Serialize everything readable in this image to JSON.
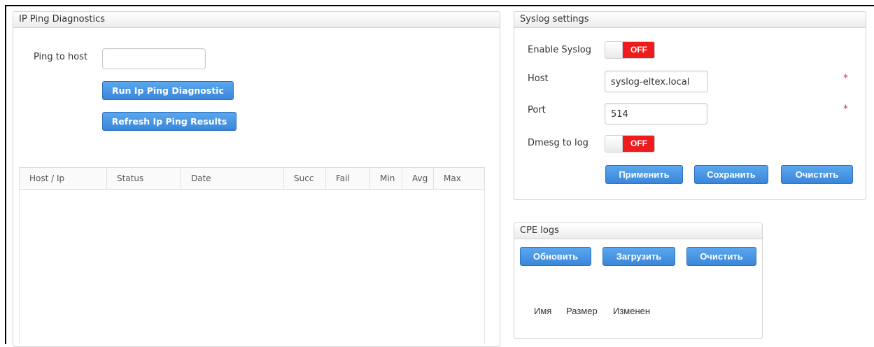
{
  "ping_panel": {
    "title": "IP Ping Diagnostics",
    "ping_label": "Ping to host",
    "ping_value": "",
    "run_button": "Run Ip Ping Diagnostic",
    "refresh_button": "Refresh Ip Ping Results",
    "columns": [
      "Host / Ip",
      "Status",
      "Date",
      "Succ",
      "Fail",
      "Min",
      "Avg",
      "Max"
    ]
  },
  "syslog_panel": {
    "title": "Syslog settings",
    "enable_label": "Enable Syslog",
    "enable_state": "OFF",
    "host_label": "Host",
    "host_value": "syslog-eltex.local",
    "port_label": "Port",
    "port_value": "514",
    "dmesg_label": "Dmesg to log",
    "dmesg_state": "OFF",
    "required_mark": "*",
    "apply_button": "Применить",
    "save_button": "Сохранить",
    "clear_button": "Очистить"
  },
  "cpe_logs_panel": {
    "title": "CPE logs",
    "refresh_button": "Обновить",
    "upload_button": "Загрузить",
    "clear_button": "Очистить",
    "columns": [
      "Имя",
      "Размер",
      "Изменен"
    ]
  },
  "colors": {
    "button_blue": "#3b86d9",
    "toggle_off_red": "#ee1c1c",
    "required_red": "#e0303a"
  }
}
